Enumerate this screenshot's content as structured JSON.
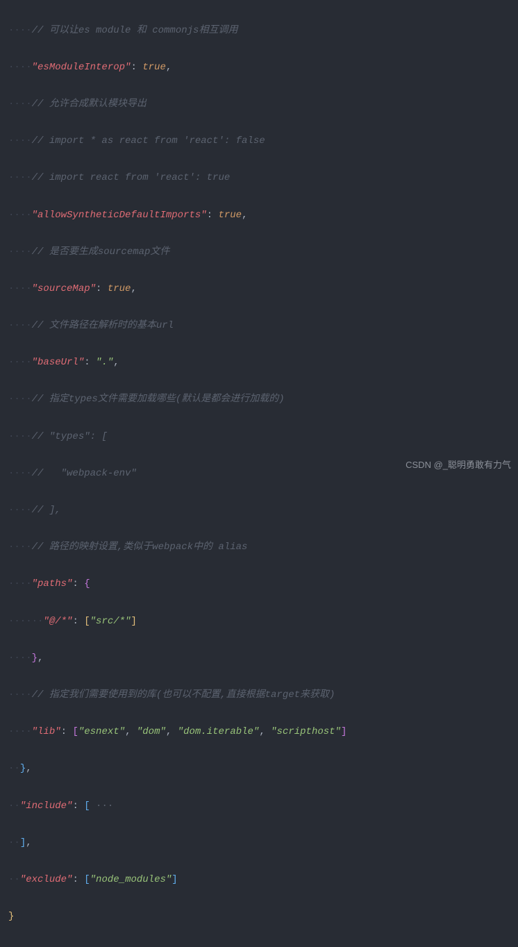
{
  "watermark": "CSDN @_聪明勇敢有力气",
  "lines": {
    "c1": "// 可以让es module 和 commonjs相互调用",
    "k_esm": "\"esModuleInterop\"",
    "v_true": "true",
    "c2": "// 允许合成默认模块导出",
    "c3": "// import * as react from 'react': false",
    "c4": "// import react from 'react': true",
    "k_asdi": "\"allowSyntheticDefaultImports\"",
    "c5": "// 是否要生成sourcemap文件",
    "k_sm": "\"sourceMap\"",
    "c6": "// 文件路径在解析时的基本url",
    "k_bu": "\"baseUrl\"",
    "v_dot": "\".\"",
    "c7": "// 指定types文件需要加载哪些(默认是都会进行加载的)",
    "c8": "// \"types\": [",
    "c9": "//   \"webpack-env\"",
    "c10": "// ],",
    "c11": "// 路径的映射设置,类似于webpack中的 alias",
    "k_paths": "\"paths\"",
    "k_at": "\"@/*\"",
    "v_src": "\"src/*\"",
    "c12": "// 指定我们需要使用到的库(也可以不配置,直接根据target来获取)",
    "k_lib": "\"lib\"",
    "v_esnext": "\"esnext\"",
    "v_dom": "\"dom\"",
    "v_domit": "\"dom.iterable\"",
    "v_sh": "\"scripthost\"",
    "k_inc": "\"include\"",
    "k_exc": "\"exclude\"",
    "v_nm": "\"node_modules\""
  }
}
